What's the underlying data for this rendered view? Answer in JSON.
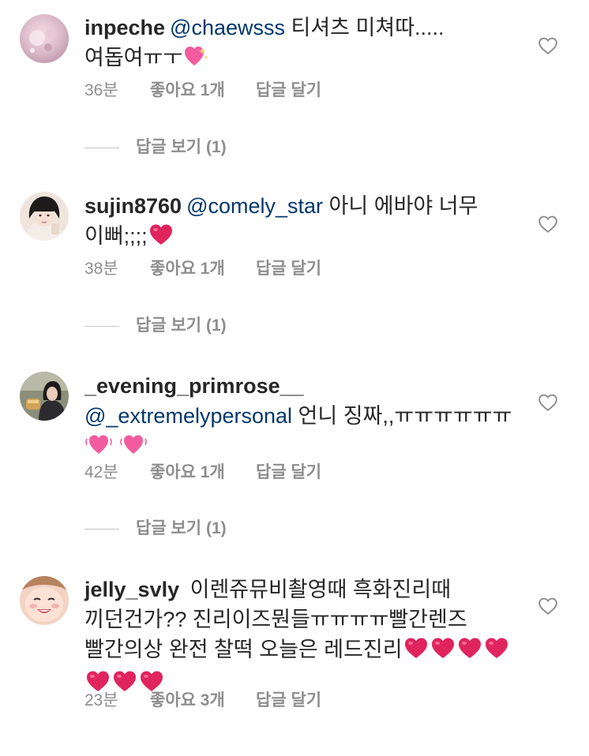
{
  "comments": [
    {
      "username": "inpeche",
      "mention": "@chaewsss",
      "text": " 티셔츠 미쳐따..... 여돕여ㅠㅜ",
      "emojis": [
        "sparkling-heart"
      ],
      "time": "36분",
      "likes": "좋아요 1개",
      "reply": "답글 달기",
      "view_replies": "답글 보기 (1)"
    },
    {
      "username": "sujin8760",
      "mention": "@comely_star",
      "text": " 아니 에바야 너무 이뻐;;;;",
      "emojis": [
        "red-heart"
      ],
      "time": "38분",
      "likes": "좋아요 1개",
      "reply": "답글 달기",
      "view_replies": "답글 보기 (1)"
    },
    {
      "username": "_evening_primrose__",
      "mention": "@_extremelypersonal",
      "text": " 언니 징짜,,ㅠㅠㅠㅠㅠㅠ",
      "emojis": [
        "beating-heart",
        "beating-heart"
      ],
      "time": "42분",
      "likes": "좋아요 1개",
      "reply": "답글 달기",
      "view_replies": "답글 보기 (1)"
    },
    {
      "username": "jelly_svly",
      "mention": "",
      "text": " 이렌쥬뮤비촬영때 흑화진리때 끼던건가?? 진리이즈뭔들ㅠㅠㅠㅠ빨간렌즈 빨간의상 완전 찰떡 오늘은 레드진리",
      "emojis": [
        "red-heart",
        "red-heart",
        "red-heart",
        "red-heart",
        "red-heart",
        "red-heart",
        "red-heart"
      ],
      "time": "23분",
      "likes": "좋아요 3개",
      "reply": "답글 달기"
    }
  ],
  "icons": {
    "like": "heart-outline-icon"
  },
  "colors": {
    "text": "#262626",
    "mention": "#00376b",
    "meta": "#8e8e8e",
    "heart_red": "#e0245e",
    "heart_pink": "#f25c9e"
  }
}
